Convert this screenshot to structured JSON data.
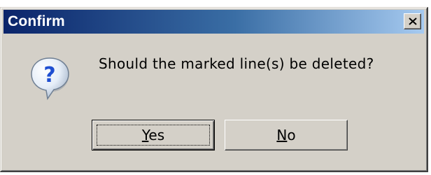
{
  "dialog": {
    "title": "Confirm",
    "message": "Should the marked line(s) be deleted?",
    "icon": "question-icon",
    "close_symbol": "✕"
  },
  "buttons": {
    "yes": {
      "mnemonic": "Y",
      "rest": "es",
      "default": true
    },
    "no": {
      "mnemonic": "N",
      "rest": "o",
      "default": false
    }
  },
  "colors": {
    "title_gradient_start": "#0a246a",
    "title_gradient_end": "#a6caf0",
    "face": "#d4d0c8",
    "icon_fill": "#1f4fd1"
  }
}
